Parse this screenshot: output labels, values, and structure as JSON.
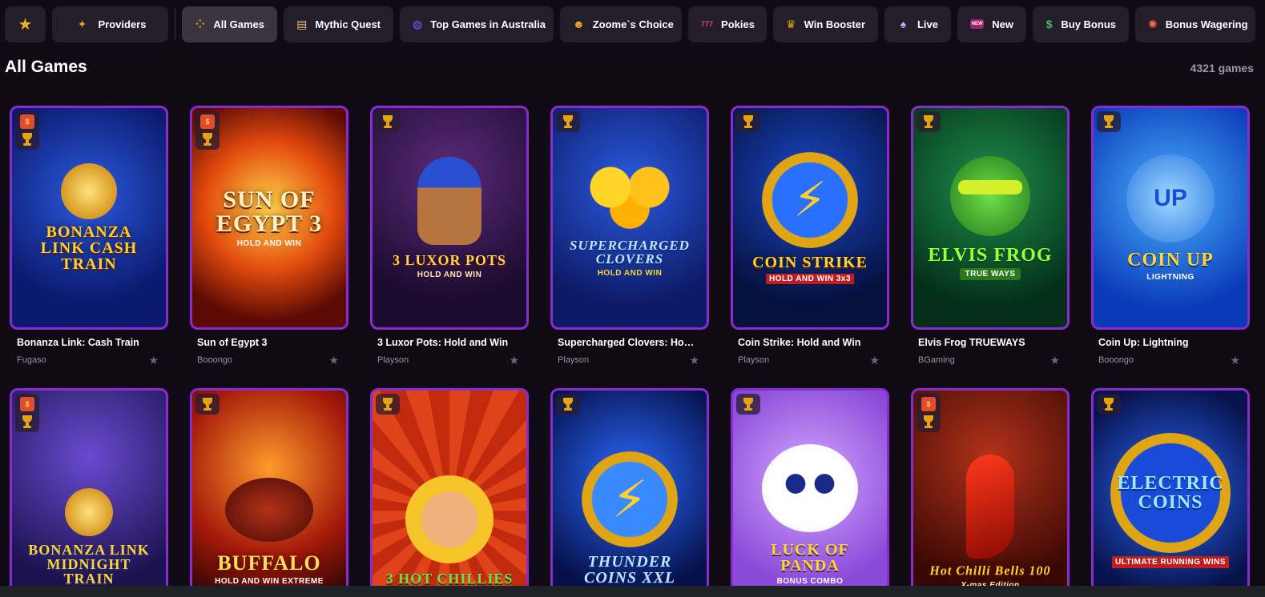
{
  "categories": [
    {
      "label": "Providers",
      "icon": "providers-icon"
    },
    {
      "label": "All Games",
      "icon": "all-games-icon",
      "active": true
    },
    {
      "label": "Mythic Quest",
      "icon": "scroll-icon"
    },
    {
      "label": "Top Games in Australia",
      "icon": "globe-icon"
    },
    {
      "label": "Zoome`s Choice",
      "icon": "smiley-icon"
    },
    {
      "label": "Pokies",
      "icon": "slot-777-icon"
    },
    {
      "label": "Win Booster",
      "icon": "trophy-icon"
    },
    {
      "label": "Live",
      "icon": "dealer-icon"
    },
    {
      "label": "New",
      "icon": "new-badge-icon"
    },
    {
      "label": "Buy Bonus",
      "icon": "money-bag-icon"
    },
    {
      "label": "Bonus Wagering",
      "icon": "bonus-icon"
    }
  ],
  "section": {
    "title": "All Games",
    "count": "4321 games"
  },
  "games": [
    {
      "name": "Bonanza Link: Cash Train",
      "provider": "Fugaso",
      "logo": "BONANZA LINK CASH TRAIN",
      "gift": true
    },
    {
      "name": "Sun of Egypt 3",
      "provider": "Booongo",
      "logo": "SUN OF EGYPT 3",
      "sub": "HOLD AND WIN",
      "gift": true
    },
    {
      "name": "3 Luxor Pots: Hold and Win",
      "provider": "Playson",
      "logo": "3 LUXOR POTS",
      "sub": "HOLD AND WIN"
    },
    {
      "name": "Supercharged Clovers: Hold ...",
      "provider": "Playson",
      "logo": "SUPERCHARGED CLOVERS",
      "sub": "HOLD AND WIN"
    },
    {
      "name": "Coin Strike: Hold and Win",
      "provider": "Playson",
      "logo": "COIN STRIKE",
      "sub": "HOLD AND WIN 3x3"
    },
    {
      "name": "Elvis Frog TRUEWAYS",
      "provider": "BGaming",
      "logo": "ELVIS FROG",
      "sub": "TRUE WAYS"
    },
    {
      "name": "Coin Up: Lightning",
      "provider": "Booongo",
      "logo": "COIN UP",
      "sub": "LIGHTNING"
    },
    {
      "name": "",
      "provider": "",
      "logo": "BONANZA LINK MIDNIGHT TRAIN",
      "gift": true
    },
    {
      "name": "",
      "provider": "",
      "logo": "BUFFALO",
      "sub": "HOLD AND WIN EXTREME"
    },
    {
      "name": "",
      "provider": "",
      "logo": "3 HOT CHILLIES"
    },
    {
      "name": "",
      "provider": "",
      "logo": "THUNDER COINS XXL"
    },
    {
      "name": "",
      "provider": "",
      "logo": "LUCK OF PANDA",
      "sub": "BONUS COMBO"
    },
    {
      "name": "",
      "provider": "",
      "logo": "Hot Chilli Bells 100",
      "sub": "X-mas Edition",
      "gift": true
    },
    {
      "name": "",
      "provider": "",
      "logo": "ELECTRIC COINS",
      "sub": "ULTIMATE RUNNING WINS"
    }
  ],
  "colors": {
    "accent_border": "#8a2bd0",
    "background": "#0f0a13",
    "chip": "#241d2a"
  }
}
